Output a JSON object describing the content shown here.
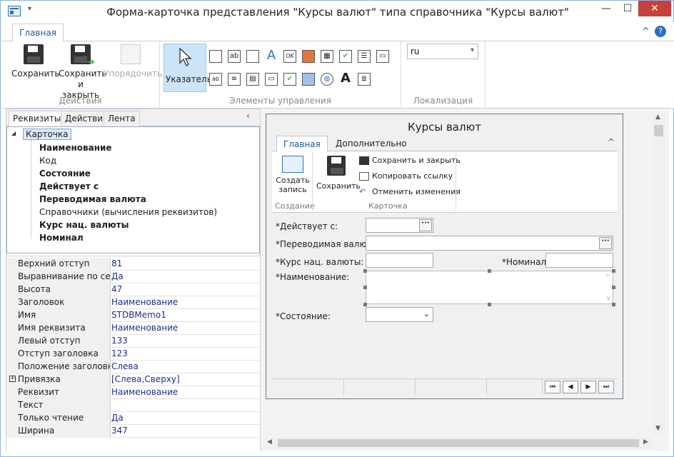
{
  "window": {
    "title": "Форма-карточка представления \"Курсы валют\" типа справочника \"Курсы валют\"",
    "minimize": "—",
    "maximize": "☐",
    "close": "✕"
  },
  "ribbon_tab": "Главная",
  "ribbon": {
    "actions": {
      "save": "Сохранить",
      "save_close_1": "Сохранить",
      "save_close_2": "и закрыть",
      "arrange": "Упорядочить",
      "group": "Действия"
    },
    "controls": {
      "pointer": "Указатель",
      "group": "Элементы управления"
    },
    "localization": {
      "value": "ru",
      "group": "Локализация"
    }
  },
  "left": {
    "tabs": [
      "Реквизиты",
      "Действия",
      "Лента"
    ],
    "tree": {
      "root": "Карточка",
      "items": [
        {
          "label": "Наименование",
          "bold": true
        },
        {
          "label": "Код",
          "bold": false
        },
        {
          "label": "Состояние",
          "bold": true
        },
        {
          "label": "Действует с",
          "bold": true
        },
        {
          "label": "Переводимая валюта",
          "bold": true
        },
        {
          "label": "Справочники (вычисления реквизитов)",
          "bold": false
        },
        {
          "label": "Курс нац. валюты",
          "bold": true
        },
        {
          "label": "Номинал",
          "bold": true
        }
      ]
    },
    "props": [
      {
        "name": "Верхний отступ",
        "value": "81"
      },
      {
        "name": "Выравнивание по сетке",
        "value": "Да"
      },
      {
        "name": "Высота",
        "value": "47"
      },
      {
        "name": "Заголовок",
        "value": "Наименование"
      },
      {
        "name": "Имя",
        "value": "STDBMemo1"
      },
      {
        "name": "Имя реквизита",
        "value": "Наименование"
      },
      {
        "name": "Левый отступ",
        "value": "133"
      },
      {
        "name": "Отступ заголовка",
        "value": "123"
      },
      {
        "name": "Положение заголовка",
        "value": "Слева"
      },
      {
        "name": "Привязка",
        "value": "[Слева,Сверху]"
      },
      {
        "name": "Реквизит",
        "value": "Наименование"
      },
      {
        "name": "Текст",
        "value": ""
      },
      {
        "name": "Только чтение",
        "value": "Да"
      },
      {
        "name": "Ширина",
        "value": "347"
      }
    ]
  },
  "form": {
    "title": "Курсы валют",
    "tabs": [
      "Главная",
      "Дополнительно"
    ],
    "create_1": "Создать",
    "create_2": "запись",
    "create_group": "Создание",
    "save": "Сохранить",
    "save_close": "Сохранить и закрыть",
    "copy_link": "Копировать ссылку",
    "cancel": "Отменить изменения",
    "card_group": "Карточка",
    "fields": {
      "valid_from": "*Действует с:",
      "currency": "*Переводимая валюта:",
      "rate": "*Курс нац. валюты:",
      "nominal": "*Номинал:",
      "name": "*Наименование:",
      "state": "*Состояние:"
    },
    "nav": [
      "⏮",
      "◀",
      "▶",
      "⏭"
    ]
  }
}
